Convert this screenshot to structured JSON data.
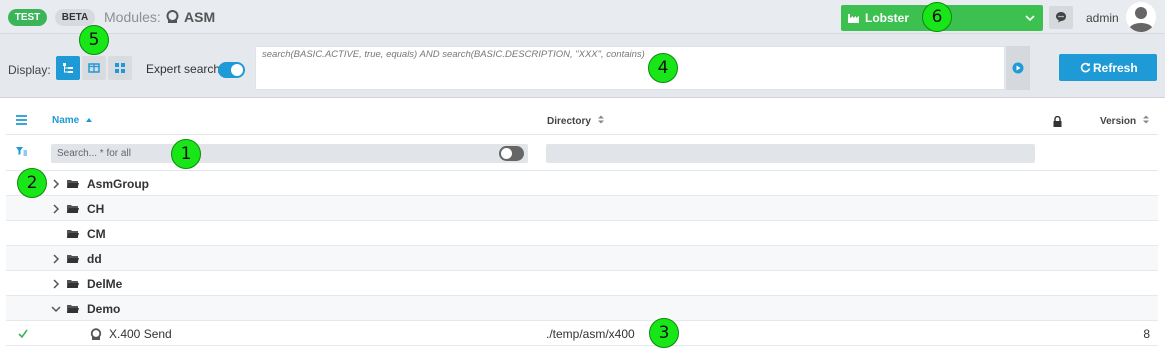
{
  "header": {
    "badge_test": "TEST",
    "badge_beta": "BETA",
    "modules_label": "Modules:",
    "module_name": "ASM",
    "tenant": "Lobster",
    "user": "admin"
  },
  "toolbar": {
    "display_label": "Display:",
    "expert_search_label": "Expert search",
    "expert_search_enabled": true,
    "query": "search(BASIC.ACTIVE, true, equals) AND search(BASIC.DESCRIPTION, \"XXX\", contains)",
    "refresh_label": "Refresh"
  },
  "table": {
    "columns": {
      "name": "Name",
      "directory": "Directory",
      "version": "Version"
    },
    "filter": {
      "placeholder": "Search... * for all",
      "toggle_on": false
    },
    "rows": [
      {
        "label": "AsmGroup",
        "type": "folder",
        "expandable": true,
        "expanded": false,
        "directory": "",
        "version": ""
      },
      {
        "label": "CH",
        "type": "folder",
        "expandable": true,
        "expanded": false,
        "directory": "",
        "version": ""
      },
      {
        "label": "CM",
        "type": "folder",
        "expandable": false,
        "expanded": false,
        "directory": "",
        "version": ""
      },
      {
        "label": "dd",
        "type": "folder",
        "expandable": true,
        "expanded": false,
        "directory": "",
        "version": ""
      },
      {
        "label": "DelMe",
        "type": "folder",
        "expandable": true,
        "expanded": false,
        "directory": "",
        "version": ""
      },
      {
        "label": "Demo",
        "type": "folder",
        "expandable": true,
        "expanded": true,
        "directory": "",
        "version": ""
      },
      {
        "label": "X.400 Send",
        "type": "asm",
        "active": true,
        "directory": "./temp/asm/x400",
        "version": "8"
      }
    ]
  },
  "annotations": [
    "1",
    "2",
    "3",
    "4",
    "5",
    "6"
  ],
  "colors": {
    "accent": "#1e9ad6",
    "tenant": "#3cc04f",
    "test_badge": "#3cb55a",
    "marker": "#19e619"
  }
}
